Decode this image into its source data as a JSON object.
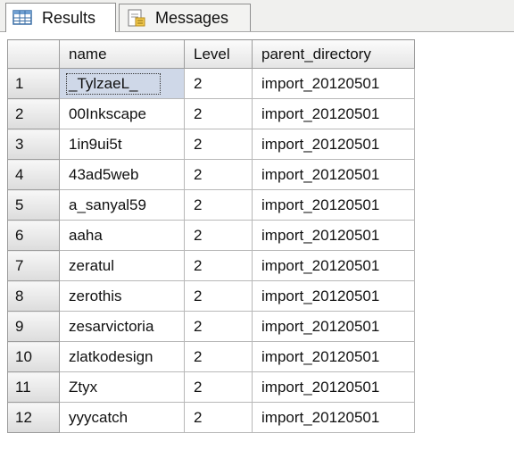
{
  "tabs": [
    {
      "label": "Results",
      "icon": "grid-icon",
      "active": true
    },
    {
      "label": "Messages",
      "icon": "messages-icon",
      "active": false
    }
  ],
  "grid": {
    "columns": [
      "name",
      "Level",
      "parent_directory"
    ],
    "rows": [
      {
        "num": "1",
        "name": "_TylzaeL_",
        "level": "2",
        "parent": "import_20120501",
        "selected": true
      },
      {
        "num": "2",
        "name": "00Inkscape",
        "level": "2",
        "parent": "import_20120501"
      },
      {
        "num": "3",
        "name": "1in9ui5t",
        "level": "2",
        "parent": "import_20120501"
      },
      {
        "num": "4",
        "name": "43ad5web",
        "level": "2",
        "parent": "import_20120501"
      },
      {
        "num": "5",
        "name": "a_sanyal59",
        "level": "2",
        "parent": "import_20120501"
      },
      {
        "num": "6",
        "name": "aaha",
        "level": "2",
        "parent": "import_20120501"
      },
      {
        "num": "7",
        "name": "zeratul",
        "level": "2",
        "parent": "import_20120501"
      },
      {
        "num": "8",
        "name": "zerothis",
        "level": "2",
        "parent": "import_20120501"
      },
      {
        "num": "9",
        "name": "zesarvictoria",
        "level": "2",
        "parent": "import_20120501"
      },
      {
        "num": "10",
        "name": "zlatkodesign",
        "level": "2",
        "parent": "import_20120501"
      },
      {
        "num": "11",
        "name": "Ztyx",
        "level": "2",
        "parent": "import_20120501"
      },
      {
        "num": "12",
        "name": "yyycatch",
        "level": "2",
        "parent": "import_20120501"
      }
    ]
  },
  "colors": {
    "selection": "#cfd8e8",
    "header_bg": "#e4e4e4",
    "grid_line": "#b8b8b8"
  }
}
